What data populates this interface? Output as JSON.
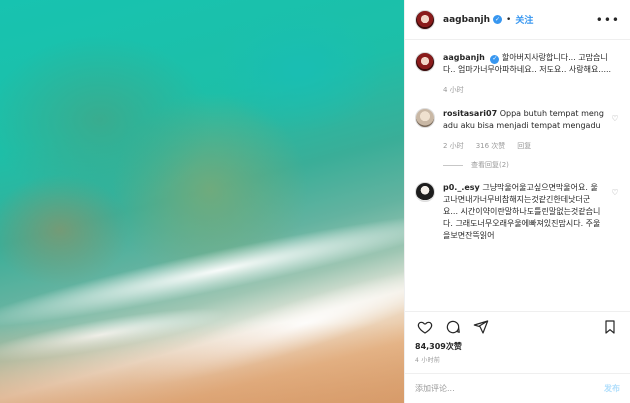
{
  "header": {
    "username": "aagbanjh",
    "verified_badge": "✓",
    "separator": "•",
    "follow_label": "关注",
    "more_label": "•••"
  },
  "comments": [
    {
      "username": "aagbanjh",
      "verified": true,
      "text": "할아버지사랑합니다... 고맙습니다.. 엄마가너무아파하네요.. 저도요.. 사랑해요.....",
      "time": "4 小时",
      "likes": "",
      "reply": ""
    },
    {
      "username": "rositasari07",
      "text": "Oppa butuh tempat mengadu aku bisa menjadi tempat mengadu",
      "time": "2 小时",
      "likes": "316 次赞",
      "reply": "回复",
      "view_replies": "查看回复(2)"
    },
    {
      "username": "p0._.esy",
      "text": "그냥막울어울고싶으면막울어요. 울고나면내가너무비참해지는것같긴한데낫더군요... 시간이약이란말하나도틀린말없는것같습니다. 그래도너무오래우울에빠져있진맙시다. 주울을보면잔뜩읽어",
      "time": "",
      "likes": "",
      "reply": ""
    }
  ],
  "actions": {
    "like_icon": "heart-outline",
    "comment_icon": "speech-bubble",
    "share_icon": "paper-plane",
    "save_icon": "bookmark"
  },
  "likes_count": "84,309次赞",
  "post_time": "4 小时前",
  "add_comment": {
    "placeholder": "添加评论...",
    "post_label": "发布"
  }
}
